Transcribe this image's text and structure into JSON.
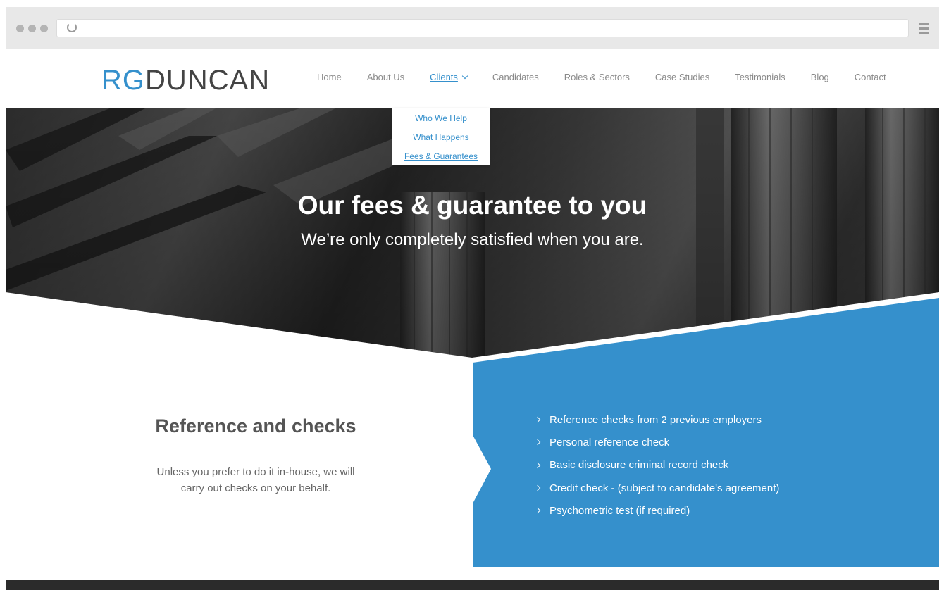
{
  "site": {
    "logo_part1": "RG",
    "logo_part2": "DUNCAN",
    "nav": [
      {
        "label": "Home"
      },
      {
        "label": "About Us"
      },
      {
        "label": "Clients"
      },
      {
        "label": "Candidates"
      },
      {
        "label": "Roles & Sectors"
      },
      {
        "label": "Case Studies"
      },
      {
        "label": "Testimonials"
      },
      {
        "label": "Blog"
      },
      {
        "label": "Contact"
      }
    ],
    "active_nav": "Clients"
  },
  "dropdown": {
    "items": [
      {
        "label": "Who We Help"
      },
      {
        "label": "What Happens"
      },
      {
        "label": "Fees & Guarantees"
      }
    ],
    "current": "Fees & Guarantees"
  },
  "hero": {
    "title": "Our fees & guarantee to you",
    "subtitle": "We’re only completely satisfied when you are."
  },
  "section": {
    "heading": "Reference and checks",
    "body": "Unless you prefer to do it in-house, we will carry out checks on your behalf.",
    "checks": [
      "Reference checks from 2 previous employers",
      "Personal reference check",
      "Basic disclosure criminal record check",
      "Credit check - (subject to candidate's agreement)",
      "Psychometric test (if required)"
    ]
  },
  "colors": {
    "accent": "#3590cc",
    "panel": "#3590cc",
    "text_dark": "#555555"
  }
}
